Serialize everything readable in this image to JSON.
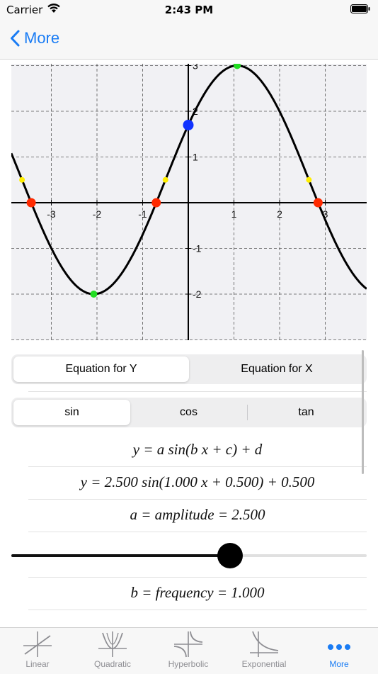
{
  "status": {
    "carrier": "Carrier",
    "time": "2:43 PM"
  },
  "nav": {
    "back_label": "More"
  },
  "graph": {
    "x_ticks": [
      "-3",
      "-2",
      "-1",
      "1",
      "2",
      "3"
    ],
    "y_ticks": [
      "-2",
      "-1",
      "1",
      "2",
      "3"
    ],
    "a": 2.5,
    "b": 1.0,
    "c": 0.5,
    "d": 0.5,
    "curve_color": "#000000",
    "root_color": "#ff2a00",
    "extremum_color": "#22dd22",
    "yint_color": "#1133ff",
    "mid_color": "#ffee00"
  },
  "segment_equation": {
    "options": [
      "Equation for Y",
      "Equation for X"
    ],
    "selected": 0
  },
  "segment_function": {
    "options": [
      "sin",
      "cos",
      "tan"
    ],
    "selected": 0
  },
  "formula": {
    "general": "y = a sin(b x + c) + d",
    "specific": "y = 2.500 sin(1.000 x + 0.500) + 0.500",
    "amplitude": "a = amplitude = 2.500",
    "frequency": "b = frequency = 1.000"
  },
  "slider": {
    "amplitude_fraction": 0.615
  },
  "tabs": [
    {
      "label": "Linear",
      "icon": "linear-graph-icon"
    },
    {
      "label": "Quadratic",
      "icon": "quadratic-graph-icon"
    },
    {
      "label": "Hyperbolic",
      "icon": "hyperbolic-graph-icon"
    },
    {
      "label": "Exponential",
      "icon": "exponential-graph-icon"
    },
    {
      "label": "More",
      "icon": "more-dots-icon",
      "active": true
    }
  ],
  "colors": {
    "accent": "#1a7cf4"
  }
}
